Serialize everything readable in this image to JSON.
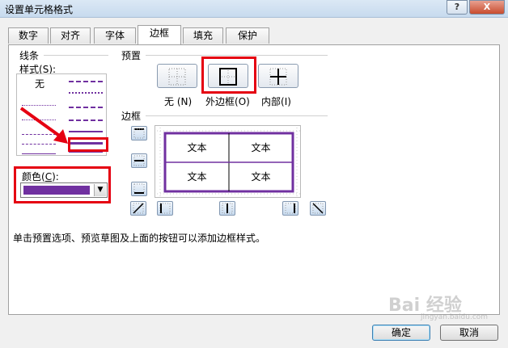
{
  "window": {
    "title": "设置单元格格式",
    "help_glyph": "?",
    "close_glyph": "X"
  },
  "tabs": [
    {
      "label": "数字"
    },
    {
      "label": "对齐"
    },
    {
      "label": "字体"
    },
    {
      "label": "边框",
      "active": true
    },
    {
      "label": "填充"
    },
    {
      "label": "保护"
    }
  ],
  "line_group": {
    "title": "线条",
    "style_label": "样式(",
    "style_key": "S",
    "style_suffix": "):",
    "none_label": "无",
    "color_label": "颜色(",
    "color_key": "C",
    "color_suffix": "):",
    "selected_color": "#7030a0"
  },
  "presets": {
    "title": "预置",
    "items": [
      {
        "label": "无",
        "key": "(N)"
      },
      {
        "label": "外边框",
        "key": "(O)"
      },
      {
        "label": "内部",
        "key": "(I)"
      }
    ]
  },
  "border": {
    "title": "边框",
    "preview_cells": [
      "文本",
      "文本",
      "文本",
      "文本"
    ]
  },
  "description": "单击预置选项、预览草图及上面的按钮可以添加边框样式。",
  "buttons": {
    "ok": "确定",
    "cancel": "取消"
  },
  "watermark": {
    "text": "Bai 经验",
    "sub": "jingyan.baidu.com"
  },
  "colors": {
    "highlight": "#e50012",
    "accent": "#7030a0"
  }
}
